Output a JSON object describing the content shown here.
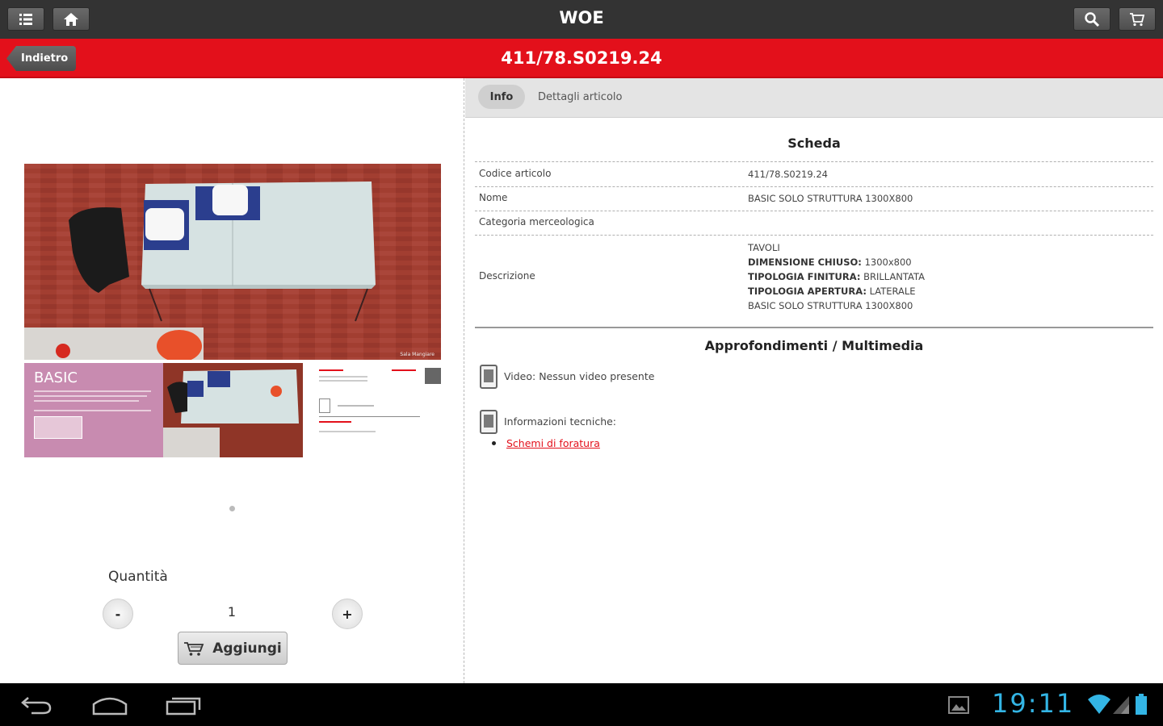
{
  "app": {
    "title": "WOE"
  },
  "nav": {
    "back_label": "Indietro",
    "item_code": "411/78.S0219.24"
  },
  "tabs": [
    {
      "label": "Info",
      "active": true
    },
    {
      "label": "Dettagli articolo",
      "active": false
    }
  ],
  "gallery": {
    "photo_caption": "Sala Mangiare",
    "thumb_title": "BASIC"
  },
  "quantity": {
    "label": "Quantità",
    "value": "1",
    "minus": "-",
    "plus": "+"
  },
  "add_button": {
    "label": "Aggiungi"
  },
  "scheda": {
    "title": "Scheda",
    "rows": [
      {
        "label": "Codice articolo",
        "value": "411/78.S0219.24"
      },
      {
        "label": "Nome",
        "value": "BASIC SOLO STRUTTURA 1300X800"
      },
      {
        "label": "Categoria merceologica",
        "value": ""
      }
    ],
    "description": {
      "label": "Descrizione",
      "line1": "TAVOLI",
      "line2_key": "DIMENSIONE CHIUSO:",
      "line2_val": " 1300x800",
      "line3_key": "TIPOLOGIA FINITURA:",
      "line3_val": " BRILLANTATA",
      "line4_key": "TIPOLOGIA APERTURA:",
      "line4_val": " LATERALE",
      "line5": "BASIC SOLO STRUTTURA 1300X800"
    }
  },
  "multimedia": {
    "title": "Approfondimenti / Multimedia",
    "video_text": "Video: Nessun video presente",
    "tech_text": "Informazioni tecniche:",
    "tech_link": "Schemi di foratura"
  },
  "status": {
    "clock": "19:11"
  },
  "colors": {
    "brand_red": "#e3101b",
    "topbar": "#333333",
    "clock": "#33b5e5"
  }
}
